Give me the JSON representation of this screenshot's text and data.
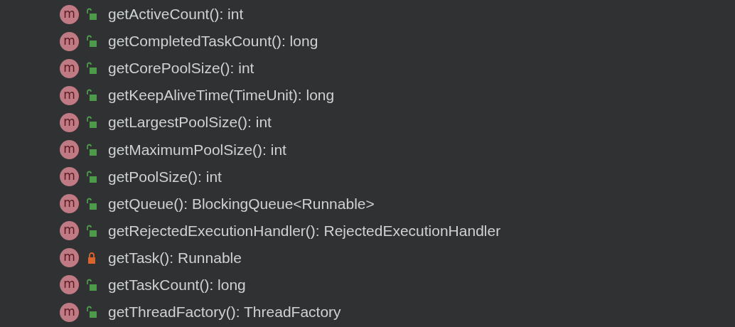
{
  "members": [
    {
      "badge": "m",
      "locked": false,
      "signature": "getActiveCount(): int"
    },
    {
      "badge": "m",
      "locked": false,
      "signature": "getCompletedTaskCount(): long"
    },
    {
      "badge": "m",
      "locked": false,
      "signature": "getCorePoolSize(): int"
    },
    {
      "badge": "m",
      "locked": false,
      "signature": "getKeepAliveTime(TimeUnit): long"
    },
    {
      "badge": "m",
      "locked": false,
      "signature": "getLargestPoolSize(): int"
    },
    {
      "badge": "m",
      "locked": false,
      "signature": "getMaximumPoolSize(): int"
    },
    {
      "badge": "m",
      "locked": false,
      "signature": "getPoolSize(): int"
    },
    {
      "badge": "m",
      "locked": false,
      "signature": "getQueue(): BlockingQueue<Runnable>"
    },
    {
      "badge": "m",
      "locked": false,
      "signature": "getRejectedExecutionHandler(): RejectedExecutionHandler"
    },
    {
      "badge": "m",
      "locked": true,
      "signature": "getTask(): Runnable"
    },
    {
      "badge": "m",
      "locked": false,
      "signature": "getTaskCount(): long"
    },
    {
      "badge": "m",
      "locked": false,
      "signature": "getThreadFactory(): ThreadFactory"
    }
  ]
}
